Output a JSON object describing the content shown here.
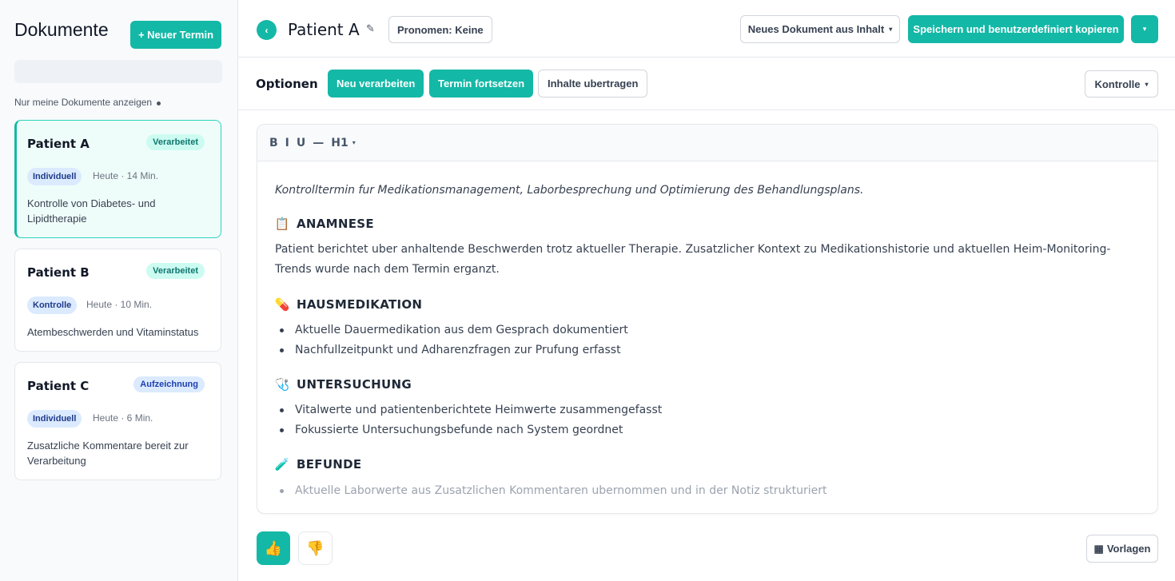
{
  "sidebar": {
    "title": "Dokumente",
    "new_button": "+ Neuer Termin",
    "search_placeholder": "",
    "filter_label": "Nur meine Dokumente anzeigen",
    "cards": [
      {
        "name": "Patient A",
        "status": "Verarbeitet",
        "type": "Individuell",
        "meta": "Heute · 14 Min.",
        "description": "Kontrolle von Diabetes- und Lipidtherapie"
      },
      {
        "name": "Patient B",
        "status": "Verarbeitet",
        "type": "Kontrolle",
        "meta": "Heute · 10 Min.",
        "description": "Atembeschwerden und Vitaminstatus"
      },
      {
        "name": "Patient C",
        "status": "Aufzeichnung",
        "type": "Individuell",
        "meta": "Heute · 6 Min.",
        "description": "Zusatzliche Kommentare bereit zur Verarbeitung"
      }
    ]
  },
  "header": {
    "back_icon": "‹",
    "patient_name": "Patient A",
    "edit_icon": "✎",
    "pronouns": "Pronomen: Keine",
    "new_doc_button": "Neues Dokument aus Inhalt",
    "save_button": "Speichern und benutzerdefiniert kopieren",
    "caret": "▾"
  },
  "options": {
    "label": "Optionen",
    "reprocess": "Neu verarbeiten",
    "continue": "Termin fortsetzen",
    "transfer": "Inhalte ubertragen",
    "template_select": "Kontrolle"
  },
  "toolbar": {
    "bold": "B",
    "italic": "I",
    "underline": "U",
    "rule": "—",
    "heading": "H1"
  },
  "note": {
    "intro": "Kontrolltermin fur Medikationsmanagement, Laborbesprechung und Optimierung des Behandlungsplans.",
    "anamnese": {
      "icon": "📋",
      "title": "ANAMNESE",
      "text": "Patient berichtet uber anhaltende Beschwerden trotz aktueller Therapie. Zusatzlicher Kontext zu Medikationshistorie und aktuellen Heim-Monitoring-Trends wurde nach dem Termin erganzt."
    },
    "hausmedikation": {
      "icon": "💊",
      "title": "HAUSMEDIKATION",
      "items": [
        "Aktuelle Dauermedikation aus dem Gesprach dokumentiert",
        "Nachfullzeitpunkt und Adharenzfragen zur Prufung erfasst"
      ]
    },
    "untersuchung": {
      "icon": "🩺",
      "title": "UNTERSUCHUNG",
      "items": [
        "Vitalwerte und patientenberichtete Heimwerte zusammengefasst",
        "Fokussierte Untersuchungsbefunde nach System geordnet"
      ]
    },
    "befunde": {
      "icon": "🧪",
      "title": "BEFUNDE",
      "items": [
        "Aktuelle Laborwerte aus Zusatzlichen Kommentaren ubernommen und in der Notiz strukturiert"
      ]
    }
  },
  "footer": {
    "thumb_up": "👍",
    "thumb_down": "👎",
    "templates_icon": "▦",
    "templates_button": "Vorlagen"
  },
  "colors": {
    "accent": "#14b8a6",
    "accent_light": "#ccfbf1",
    "badge_blue": "#dbeafe"
  }
}
